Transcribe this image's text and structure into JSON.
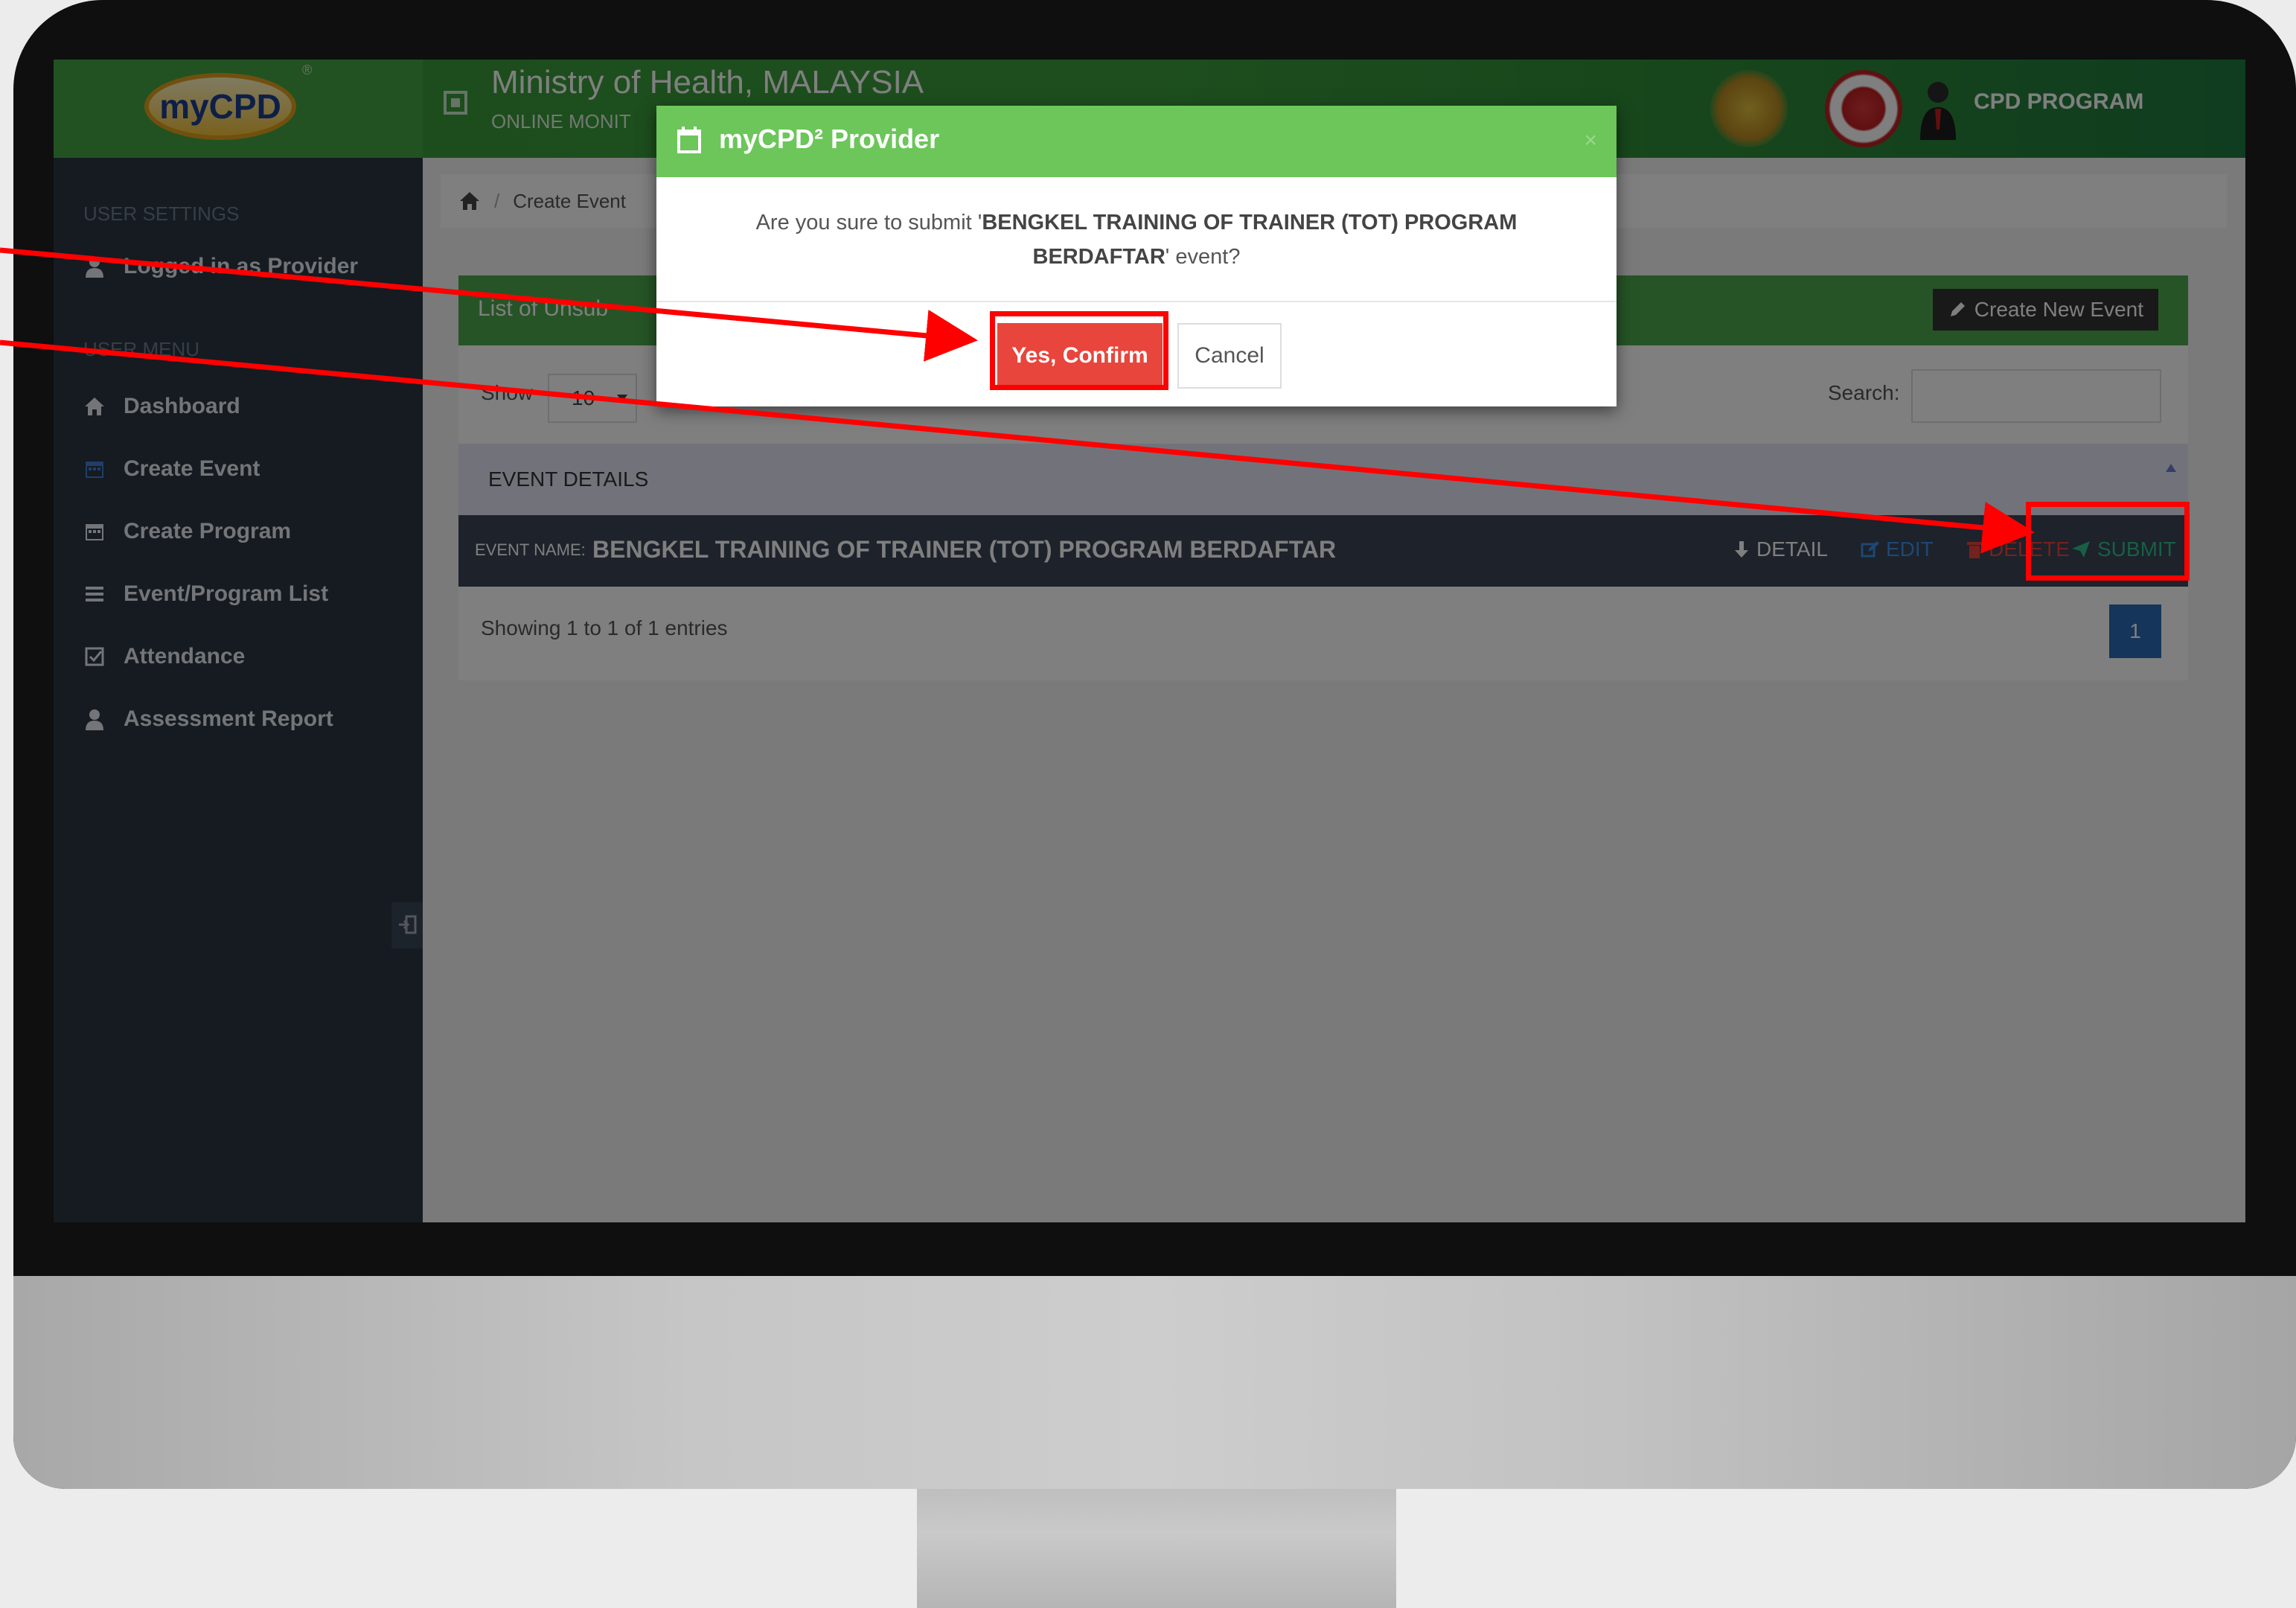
{
  "header": {
    "logo_text": "myCPD",
    "logo_reg": "®",
    "title": "Ministry of Health, MALAYSIA",
    "subtitle": "ONLINE MONIT",
    "user_label": "CPD PROGRAM"
  },
  "sidebar": {
    "settings_heading": "USER SETTINGS",
    "logged_in": "Logged in as Provider",
    "menu_heading": "USER MENU",
    "items": [
      {
        "label": "Dashboard",
        "icon": "home-icon"
      },
      {
        "label": "Create Event",
        "icon": "calendar-icon"
      },
      {
        "label": "Create Program",
        "icon": "calendar-icon"
      },
      {
        "label": "Event/Program List",
        "icon": "list-icon"
      },
      {
        "label": "Attendance",
        "icon": "checkbox-icon"
      },
      {
        "label": "Assessment Report",
        "icon": "user-icon"
      }
    ]
  },
  "breadcrumb": {
    "separator": "/",
    "current": "Create Event"
  },
  "portlet": {
    "title": "List of Unsub",
    "create_button": "Create New Event",
    "show_label": "Show",
    "show_value": "10",
    "search_label": "Search:",
    "search_value": "",
    "table_header": "EVENT DETAILS",
    "row": {
      "label": "EVENT NAME:",
      "name": "BENGKEL TRAINING OF TRAINER (TOT) PROGRAM BERDAFTAR",
      "actions": {
        "detail": "DETAIL",
        "edit": "EDIT",
        "delete": "DELETE",
        "submit": "SUBMIT"
      }
    },
    "showing": "Showing 1 to 1 of 1 entries",
    "page": "1"
  },
  "modal": {
    "title": "myCPD² Provider",
    "close": "×",
    "message_prefix": "Are you sure to submit '",
    "message_event": "BENGKEL TRAINING OF TRAINER (TOT) PROGRAM BERDAFTAR",
    "message_suffix": "' event?",
    "confirm": "Yes, Confirm",
    "cancel": "Cancel"
  },
  "colors": {
    "header_green": "#3c9d3c",
    "modal_green": "#6cc65a",
    "sidebar_dark": "#2b3643",
    "confirm_red": "#e8453c",
    "annotation_red": "#ff0000"
  }
}
